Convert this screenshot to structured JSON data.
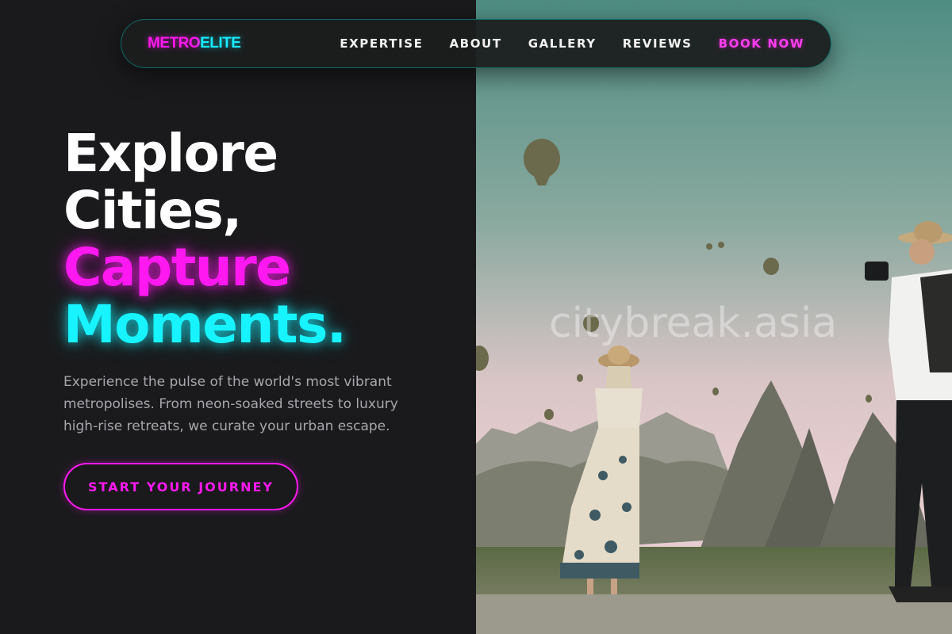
{
  "brand": {
    "part1": "METRO",
    "part2": "ELITE"
  },
  "nav": {
    "items": [
      "EXPERTISE",
      "ABOUT",
      "GALLERY",
      "REVIEWS"
    ],
    "book_label": "BOOK NOW"
  },
  "hero": {
    "line1": "Explore",
    "line2": "Cities,",
    "line3": "Capture",
    "line4": "Moments.",
    "subtitle": "Experience the pulse of the world's most vibrant metropolises. From neon-soaked streets to luxury high-rise retreats, we curate your urban escape.",
    "cta_label": "START YOUR JOURNEY"
  },
  "image": {
    "watermark": "citybreak.asia"
  },
  "colors": {
    "neon_pink": "#ff19f0",
    "neon_cyan": "#17f3ff",
    "background": "#1a1a1c"
  }
}
